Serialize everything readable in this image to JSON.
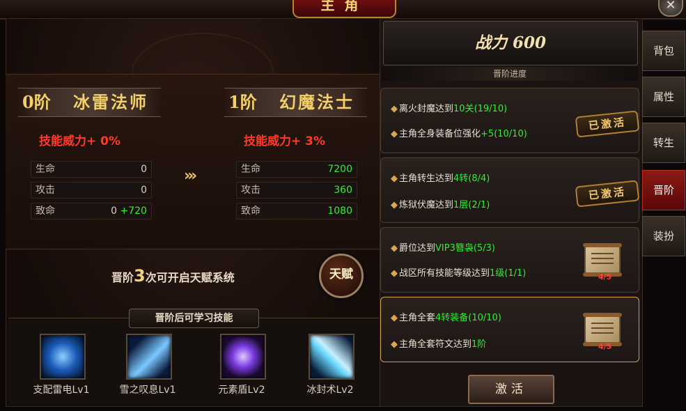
{
  "window": {
    "title": "主角",
    "close_label": "✕"
  },
  "left": {
    "current": {
      "rank": "0阶",
      "class_name": "冰雷法师",
      "power_bonus": "技能威力+ 0%"
    },
    "next": {
      "rank": "1阶",
      "class_name": "幻魔法士",
      "power_bonus": "技能威力+ 3%"
    },
    "arrows": "›››",
    "stats_current": [
      {
        "label": "生命",
        "value": "0",
        "bonus": ""
      },
      {
        "label": "攻击",
        "value": "0",
        "bonus": ""
      },
      {
        "label": "致命",
        "value": "0",
        "bonus": "+720"
      }
    ],
    "stats_next": [
      {
        "label": "生命",
        "value": "7200"
      },
      {
        "label": "攻击",
        "value": "360"
      },
      {
        "label": "致命",
        "value": "1080"
      }
    ],
    "talent_text_before": "晋阶",
    "talent_count": "3",
    "talent_text_after": "次可开启天赋系统",
    "talent_button": "天赋",
    "skills_header": "晋阶后可学习技能",
    "skills": [
      {
        "name": "支配雷电Lv1",
        "color": "#3aa0ff"
      },
      {
        "name": "雪之叹息Lv1",
        "color": "#5ab8ff"
      },
      {
        "name": "元素盾Lv2",
        "color": "#9a5aff"
      },
      {
        "name": "冰封术Lv2",
        "color": "#4ac8ff"
      }
    ]
  },
  "right": {
    "power_label": "战力 600",
    "progress_label": "晋阶进度",
    "conditions": [
      {
        "lines": [
          {
            "text": "离火封魔达到",
            "hi": "10关",
            "tail": "(19/10)"
          },
          {
            "text": "主角全身装备位强化",
            "hi": "+5",
            "tail": "(10/10)"
          }
        ],
        "status": "已激活",
        "badge": ""
      },
      {
        "lines": [
          {
            "text": "主角转生达到",
            "hi": "4转",
            "tail": "(8/4)"
          },
          {
            "text": "炼狱伏魔达到",
            "hi": "1层",
            "tail": "(2/1)"
          }
        ],
        "status": "已激活",
        "badge": ""
      },
      {
        "lines": [
          {
            "text": "爵位达到",
            "hi": "VIP3簪袅",
            "tail": "(5/3)"
          },
          {
            "text": "战区所有技能等级达到",
            "hi": "1级",
            "tail": "(1/1)"
          }
        ],
        "status": "",
        "badge": "4/5"
      },
      {
        "lines": [
          {
            "text": "主角全套",
            "hi": "4转",
            "tail": "装备(10/10)"
          },
          {
            "text": "主角全套符文达到",
            "hi": "1阶",
            "tail": ""
          }
        ],
        "status": "",
        "badge": "4/5"
      }
    ],
    "activate_button": "激活"
  },
  "tabs": [
    "背包",
    "属性",
    "转生",
    "晋阶",
    "装扮"
  ],
  "active_tab": "晋阶"
}
